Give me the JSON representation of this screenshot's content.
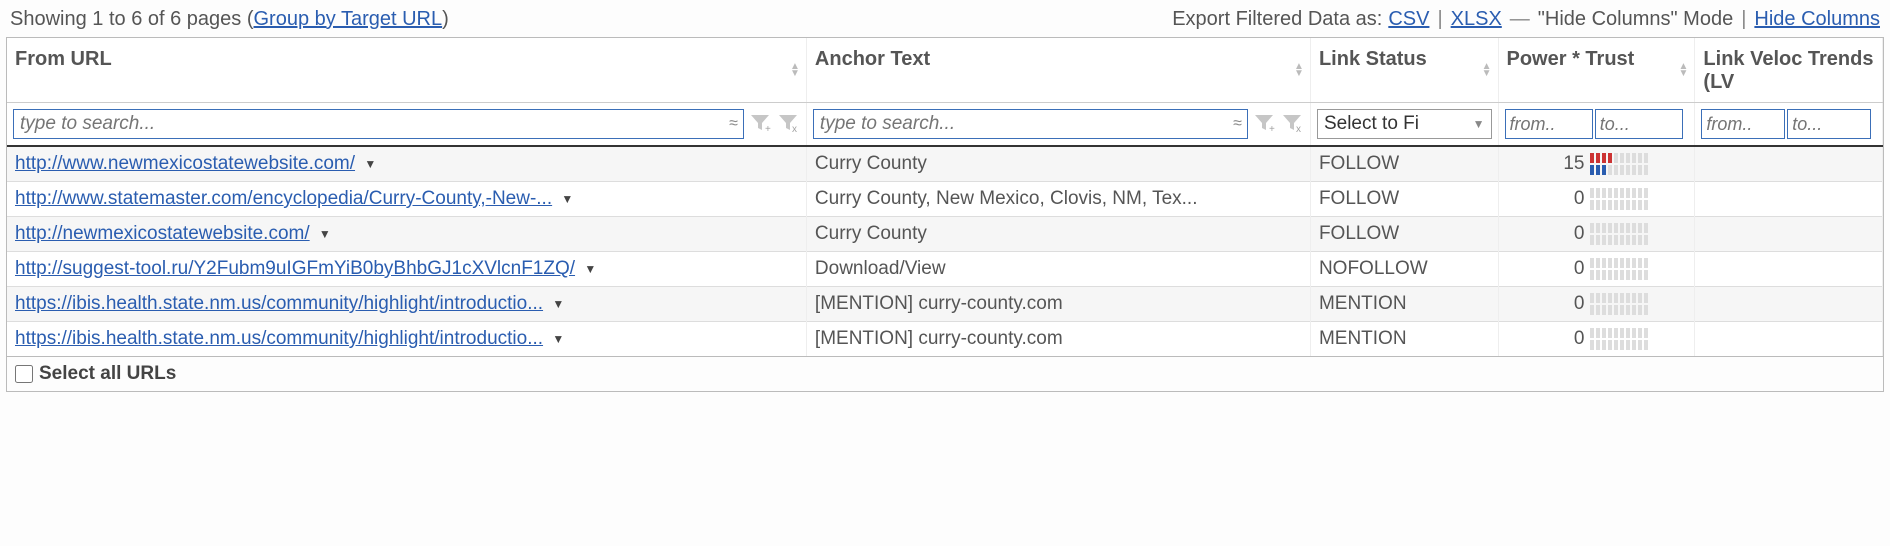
{
  "topbar": {
    "showing_text": "Showing 1 to 6 of 6 pages (",
    "group_link": "Group by Target URL",
    "showing_close": ")",
    "export_label": "Export Filtered Data as:",
    "csv": "CSV",
    "xlsx": "XLSX",
    "hide_mode": "\"Hide Columns\" Mode",
    "hide_cols": "Hide Columns",
    "pipe": "|",
    "dash": "—"
  },
  "headers": {
    "from_url": "From URL",
    "anchor": "Anchor Text",
    "link_status": "Link Status",
    "power_trust": "Power * Trust",
    "link_velocity": "Link Veloc Trends (LV"
  },
  "filters": {
    "search_placeholder": "type to search...",
    "select_label": "Select to Fi",
    "from_placeholder": "from..",
    "to_placeholder": "to..."
  },
  "rows": [
    {
      "url": "http://www.newmexicostatewebsite.com/",
      "anchor": "Curry County",
      "status": "FOLLOW",
      "pt": "15",
      "spark": "active"
    },
    {
      "url": "http://www.statemaster.com/encyclopedia/Curry-County,-New-...",
      "anchor": "Curry County, New Mexico, Clovis, NM, Tex...",
      "status": "FOLLOW",
      "pt": "0",
      "spark": "empty"
    },
    {
      "url": "http://newmexicostatewebsite.com/",
      "anchor": "Curry County",
      "status": "FOLLOW",
      "pt": "0",
      "spark": "empty"
    },
    {
      "url": "http://suggest-tool.ru/Y2Fubm9uIGFmYiB0byBhbGJ1cXVlcnF1ZQ/",
      "anchor": "Download/View",
      "status": "NOFOLLOW",
      "pt": "0",
      "spark": "empty"
    },
    {
      "url": "https://ibis.health.state.nm.us/community/highlight/introductio...",
      "anchor": "[MENTION] curry-county.com",
      "status": "MENTION",
      "pt": "0",
      "spark": "empty"
    },
    {
      "url": "https://ibis.health.state.nm.us/community/highlight/introductio...",
      "anchor": "[MENTION] curry-county.com",
      "status": "MENTION",
      "pt": "0",
      "spark": "empty"
    }
  ],
  "footer": {
    "select_all": "Select all URLs"
  }
}
